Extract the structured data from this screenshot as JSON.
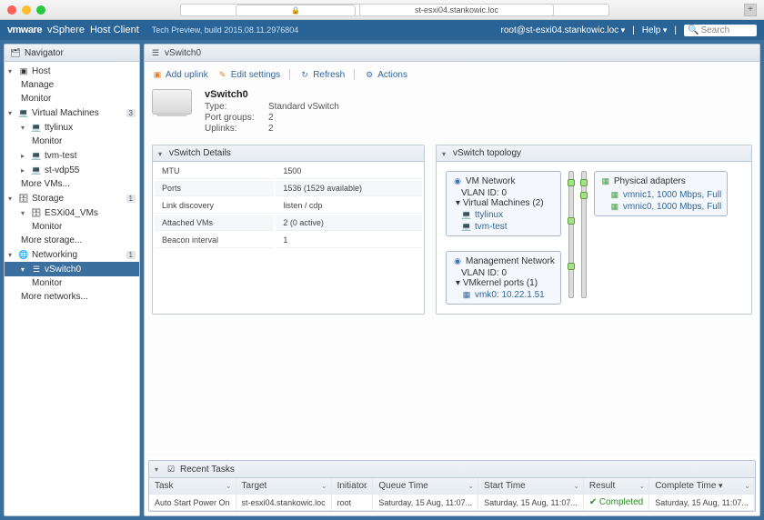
{
  "mac": {
    "url": "st-esxi04.stankowic.loc"
  },
  "header": {
    "product_bold": "vmware",
    "product": "vSphere",
    "sub": "Host Client",
    "build": "Tech Preview, build 2015.08.11.2976804",
    "user": "root@st-esxi04.stankowic.loc",
    "help": "Help",
    "search_placeholder": "Search"
  },
  "nav": {
    "title": "Navigator",
    "host": "Host",
    "manage": "Manage",
    "monitor": "Monitor",
    "vms": "Virtual Machines",
    "vms_badge": "3",
    "vm1": "ttylinux",
    "vm2": "tvm-test",
    "vm3": "st-vdp55",
    "more_vms": "More VMs...",
    "storage": "Storage",
    "storage_badge": "1",
    "ds1": "ESXi04_VMs",
    "more_storage": "More storage...",
    "net": "Networking",
    "net_badge": "1",
    "vswitch": "vSwitch0",
    "more_net": "More networks..."
  },
  "breadcrumb": {
    "item": "vSwitch0"
  },
  "toolbar": {
    "uplink": "Add uplink",
    "edit": "Edit settings",
    "refresh": "Refresh",
    "actions": "Actions"
  },
  "summary": {
    "title": "vSwitch0",
    "type_l": "Type:",
    "type_v": "Standard vSwitch",
    "pg_l": "Port groups:",
    "pg_v": "2",
    "up_l": "Uplinks:",
    "up_v": "2"
  },
  "details": {
    "title": "vSwitch Details",
    "r1l": "MTU",
    "r1v": "1500",
    "r2l": "Ports",
    "r2v": "1536 (1529 available)",
    "r3l": "Link discovery",
    "r3v": "listen / cdp",
    "r4l": "Attached VMs",
    "r4v": "2 (0 active)",
    "r5l": "Beacon interval",
    "r5v": "1"
  },
  "topo": {
    "title": "vSwitch topology",
    "vm_net": "VM Network",
    "vlan0": "VLAN ID: 0",
    "vms2": "Virtual Machines (2)",
    "vm1": "ttylinux",
    "vm2": "tvm-test",
    "mgmt": "Management Network",
    "vmk_ports": "VMkernel ports (1)",
    "vmk0": "vmk0: 10.22.1.51",
    "phys": "Physical adapters",
    "nic1": "vmnic1, 1000 Mbps, Full",
    "nic2": "vmnic0, 1000 Mbps, Full"
  },
  "recent": {
    "title": "Recent Tasks",
    "h1": "Task",
    "h2": "Target",
    "h3": "Initiator",
    "h4": "Queue Time",
    "h5": "Start Time",
    "h6": "Result",
    "h7": "Complete Time",
    "r1c1": "Auto Start Power On",
    "r1c2": "st-esxi04.stankowic.loc",
    "r1c3": "root",
    "r1c4": "Saturday, 15 Aug, 11:07...",
    "r1c5": "Saturday, 15 Aug, 11:07...",
    "r1c6": "Completed",
    "r1c7": "Saturday, 15 Aug, 11:07..."
  }
}
